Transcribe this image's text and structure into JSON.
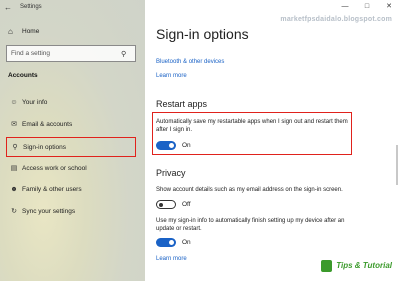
{
  "window": {
    "title": "Settings"
  },
  "sidebar": {
    "home_label": "Home",
    "search_placeholder": "Find a setting",
    "section_label": "Accounts",
    "items": [
      {
        "label": "Your info",
        "icon": "user-icon"
      },
      {
        "label": "Email & accounts",
        "icon": "mail-icon"
      },
      {
        "label": "Sign-in options",
        "icon": "key-icon"
      },
      {
        "label": "Access work or school",
        "icon": "briefcase-icon"
      },
      {
        "label": "Family & other users",
        "icon": "people-icon"
      },
      {
        "label": "Sync your settings",
        "icon": "sync-icon"
      }
    ]
  },
  "main": {
    "title": "Sign-in options",
    "link_bluetooth": "Bluetooth & other devices",
    "learn_more_1": "Learn more",
    "restart": {
      "heading": "Restart apps",
      "description": "Automatically save my restartable apps when I sign out and restart them after I sign in.",
      "toggle_state": "On"
    },
    "privacy": {
      "heading": "Privacy",
      "account_desc": "Show account details such as my email address on the sign-in screen.",
      "account_toggle": "Off",
      "signin_desc": "Use my sign-in info to automatically finish setting up my device after an update or restart.",
      "signin_toggle": "On",
      "learn_more": "Learn more"
    }
  },
  "watermark": "marketfpsdaidalo.blogspot.com",
  "brand": "Tips & Tutorial",
  "colors": {
    "accent": "#1a62c6",
    "highlight": "#e0221c"
  }
}
